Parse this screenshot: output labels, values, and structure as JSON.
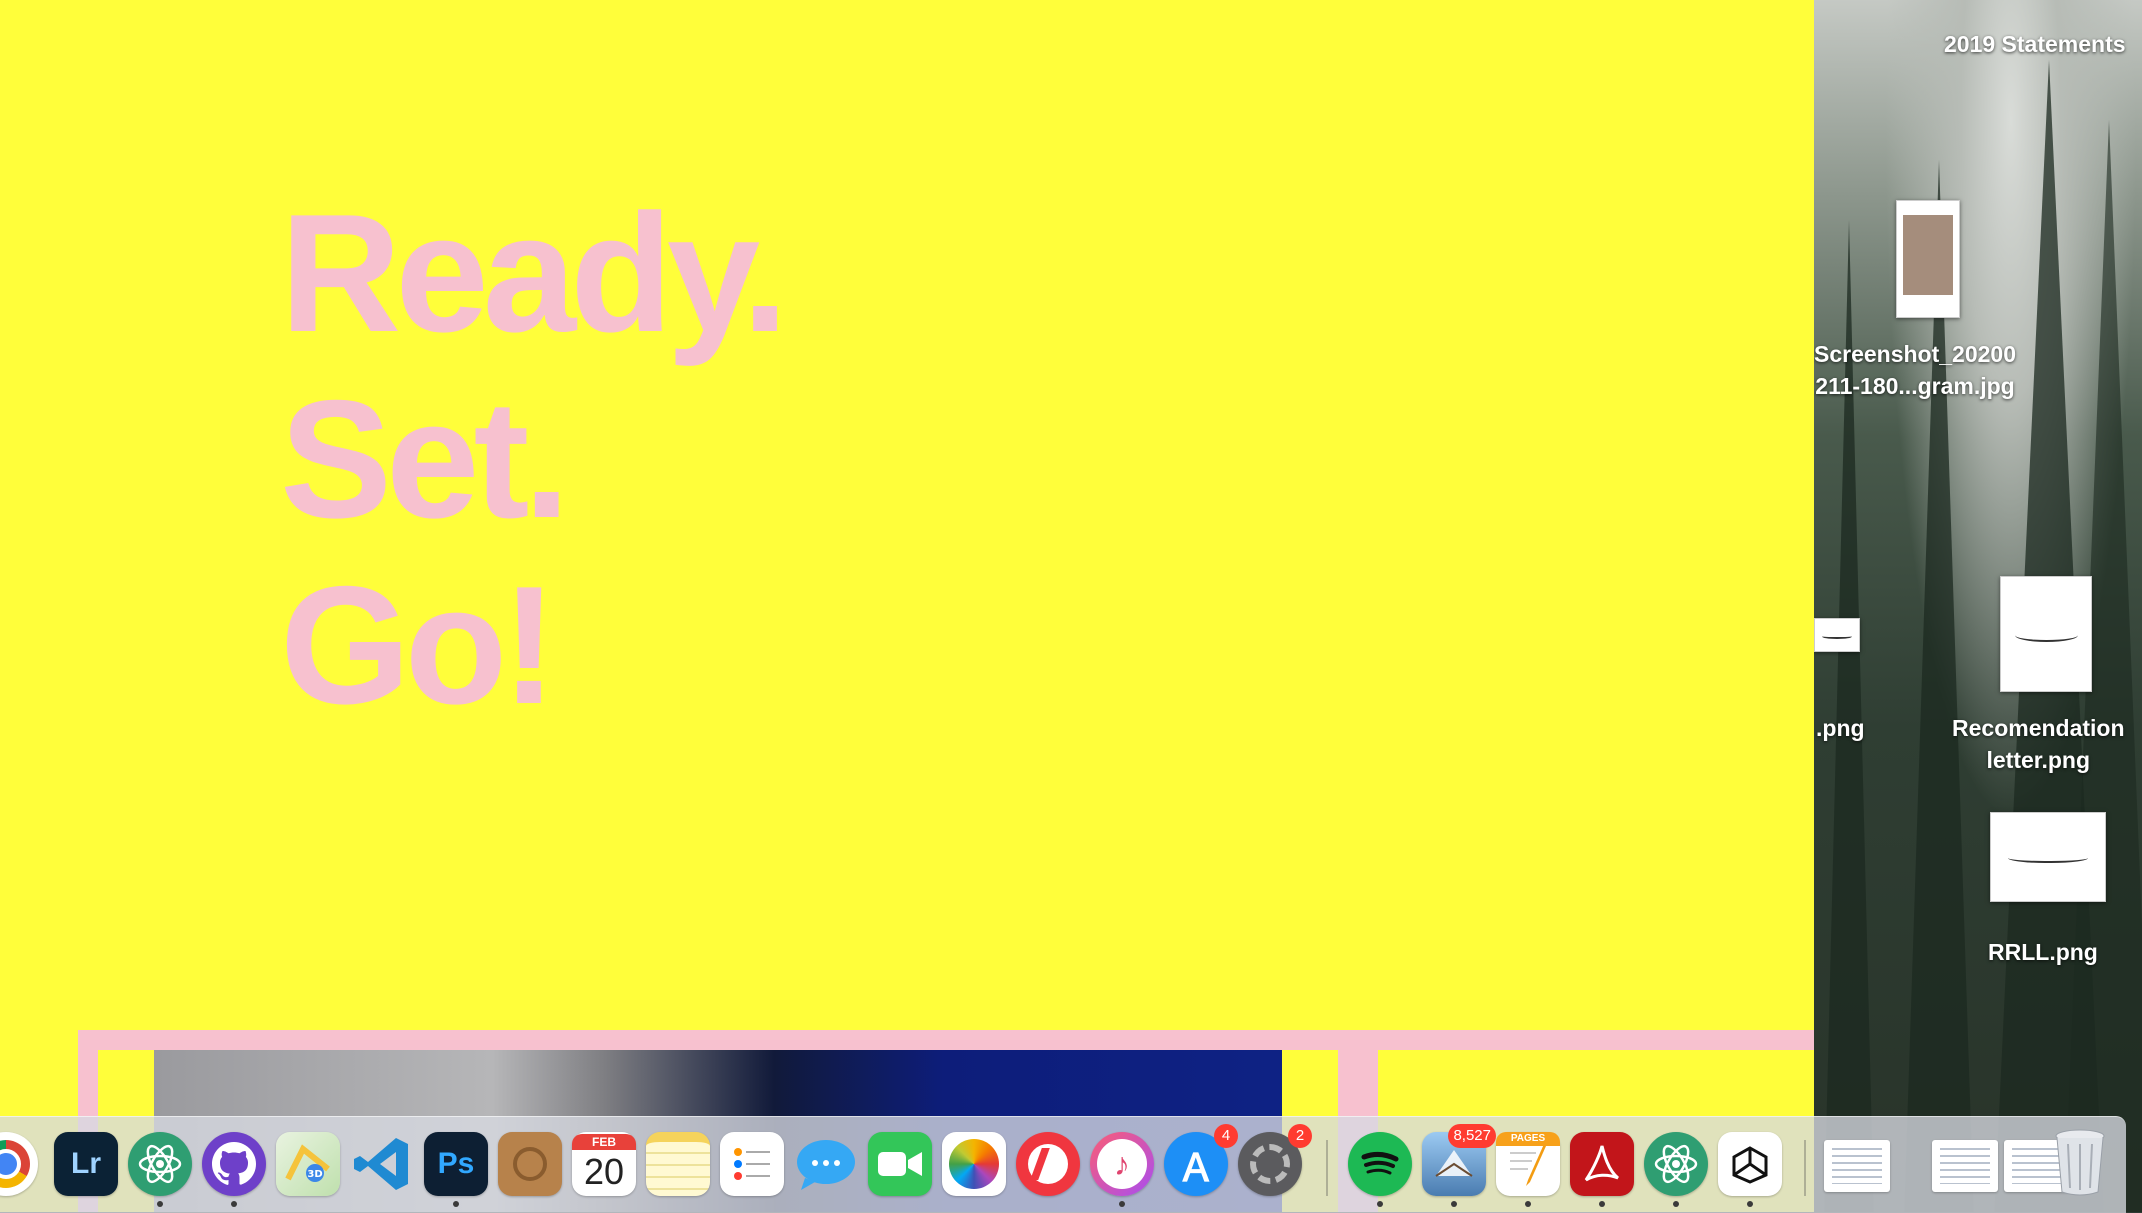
{
  "page": {
    "hero": [
      "Ready.",
      "Set.",
      "Go!"
    ],
    "colors": {
      "background": "#fffe3a",
      "accent": "#f7c1cf"
    }
  },
  "desktop": {
    "top_item": "2019 Statements",
    "files": [
      {
        "line1": "Screenshot_20200",
        "line2": "211-180...gram.jpg"
      },
      {
        "line1": ".png",
        "line2": ""
      },
      {
        "line1": "Recomendation",
        "line2": "letter.png"
      },
      {
        "line1": "RRLL.png",
        "line2": ""
      }
    ]
  },
  "dock": {
    "calendar": {
      "month": "FEB",
      "day": "20"
    },
    "badges": {
      "app_store": "4",
      "system_preferences": "2",
      "mail": "8,527"
    },
    "apps": [
      "Chrome",
      "Lightroom",
      "Atom",
      "GitHub Desktop",
      "Maps",
      "Visual Studio Code",
      "Photoshop",
      "Contacts",
      "Calendar",
      "Notes",
      "Reminders",
      "Messages",
      "FaceTime",
      "Photos",
      "News",
      "iTunes",
      "App Store",
      "System Preferences",
      "Spotify",
      "Mail",
      "Pages",
      "Acrobat",
      "Atom",
      "Unity",
      "Trash"
    ],
    "labels": {
      "lightroom": "Lr",
      "photoshop": "Ps",
      "pages": "PAGES"
    }
  }
}
